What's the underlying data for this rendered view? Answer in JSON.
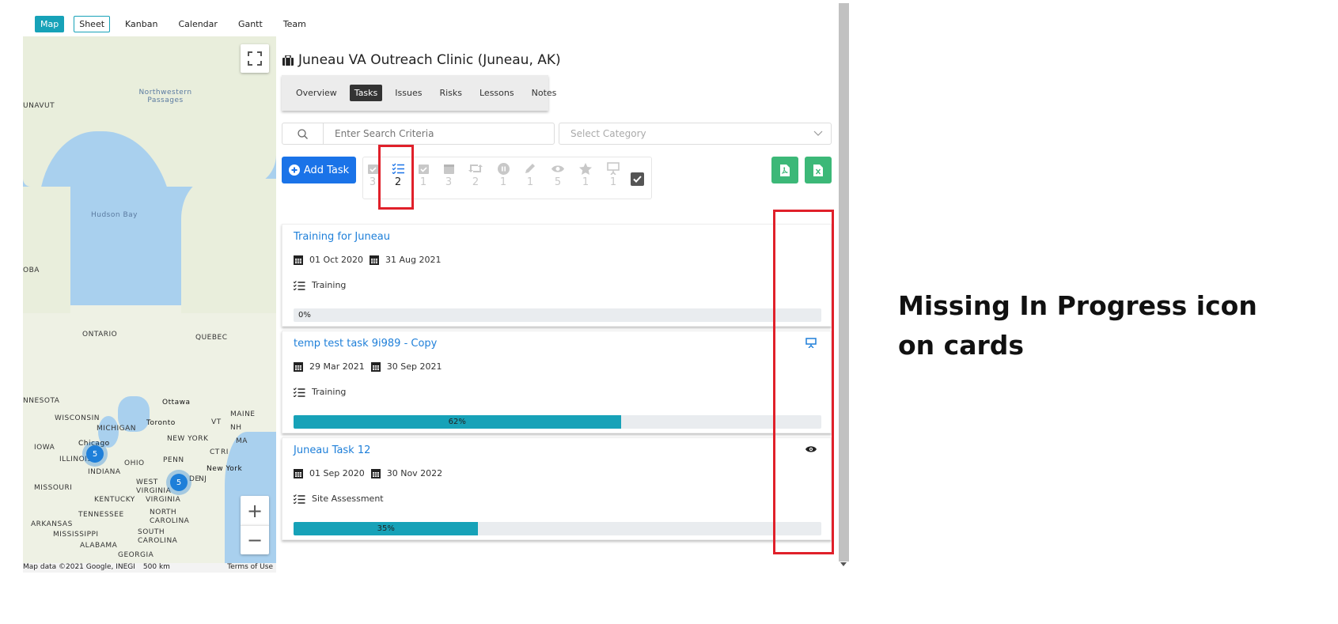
{
  "nav": {
    "tabs": [
      "Map",
      "Sheet",
      "Kanban",
      "Calendar",
      "Gantt",
      "Team"
    ]
  },
  "map": {
    "labels": [
      "Northwestern Passages",
      "UNAVUT",
      "Hudson Bay",
      "OBA",
      "ONTARIO",
      "QUEBEC",
      "NNESOTA",
      "WISCONSIN",
      "Ottawa",
      "Toronto",
      "MAINE",
      "MICHIGAN",
      "NEW YORK",
      "IOWA",
      "Chicago",
      "ILLINOIS",
      "OHIO",
      "PENN",
      "New York",
      "NJ",
      "INDIANA",
      "MISSOURI",
      "WEST VIRGINIA",
      "VIRGINIA",
      "KENTUCKY",
      "TENNESSEE",
      "NORTH CAROLINA",
      "ARKANSAS",
      "MISSISSIPPI",
      "SOUTH CAROLINA",
      "ALABAMA",
      "GEORGIA",
      "VT",
      "NH",
      "MA",
      "CT",
      "RI",
      "DE"
    ],
    "cluster_chicago": "5",
    "cluster_east": "5",
    "footer_data": "Map data ©2021 Google, INEGI",
    "footer_scale": "500 km",
    "footer_terms": "Terms of Use",
    "zoom_in": "+",
    "zoom_out": "−"
  },
  "page": {
    "title": "Juneau VA Outreach Clinic (Juneau, AK)"
  },
  "subtabs": [
    "Overview",
    "Tasks",
    "Issues",
    "Risks",
    "Lessons",
    "Notes"
  ],
  "search": {
    "placeholder": "Enter Search Criteria",
    "category_placeholder": "Select Category"
  },
  "add_button": "Add Task",
  "filters": [
    {
      "icon": "calendar-check-icon",
      "count": "3"
    },
    {
      "icon": "list-check-icon",
      "count": "2"
    },
    {
      "icon": "calendar-check-icon",
      "count": "1"
    },
    {
      "icon": "calendar-icon",
      "count": "3"
    },
    {
      "icon": "retweet-icon",
      "count": "2"
    },
    {
      "icon": "pause-circle-icon",
      "count": "1"
    },
    {
      "icon": "pencil-icon",
      "count": "1"
    },
    {
      "icon": "eye-icon",
      "count": "5"
    },
    {
      "icon": "star-icon",
      "count": "1"
    },
    {
      "icon": "presentation-icon",
      "count": "1"
    }
  ],
  "cards": [
    {
      "title": "Training for Juneau",
      "start": "01 Oct 2020",
      "end": "31 Aug 2021",
      "category": "Training",
      "progress": 0,
      "progress_label": "0%",
      "icon": ""
    },
    {
      "title": "temp test task 9i989 - Copy",
      "start": "29 Mar 2021",
      "end": "30 Sep 2021",
      "category": "Training",
      "progress": 62,
      "progress_label": "62%",
      "icon": "presentation-icon"
    },
    {
      "title": "Juneau Task 12",
      "start": "01 Sep 2020",
      "end": "30 Nov 2022",
      "category": "Site Assessment",
      "progress": 35,
      "progress_label": "35%",
      "icon": "eye-icon"
    }
  ],
  "annotation": {
    "line1": "Missing In Progress icon",
    "line2": "on cards"
  },
  "colors": {
    "accent": "#17a2b8",
    "primary": "#1a73e8",
    "export": "#3cb878",
    "highlight": "#e0202a"
  }
}
